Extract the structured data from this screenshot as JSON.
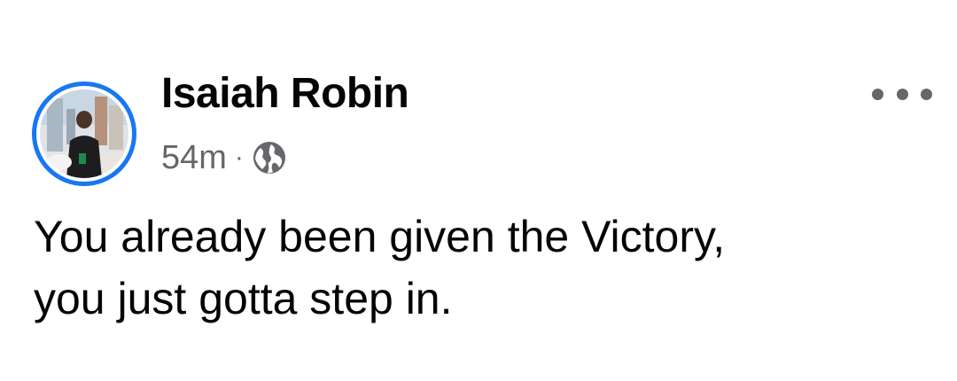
{
  "post": {
    "author": {
      "name": "Isaiah Robin",
      "avatar": "profile-photo"
    },
    "timestamp": "54m",
    "separator": "·",
    "audience_icon": "globe-icon",
    "more_icon": "more-options-icon",
    "text_lines": [
      "You already been given the Victory,",
      "you just gotta step in."
    ]
  },
  "colors": {
    "avatar_ring": "#1877f2",
    "meta_text": "#65676b",
    "body_text": "#050505",
    "background": "#ffffff"
  }
}
